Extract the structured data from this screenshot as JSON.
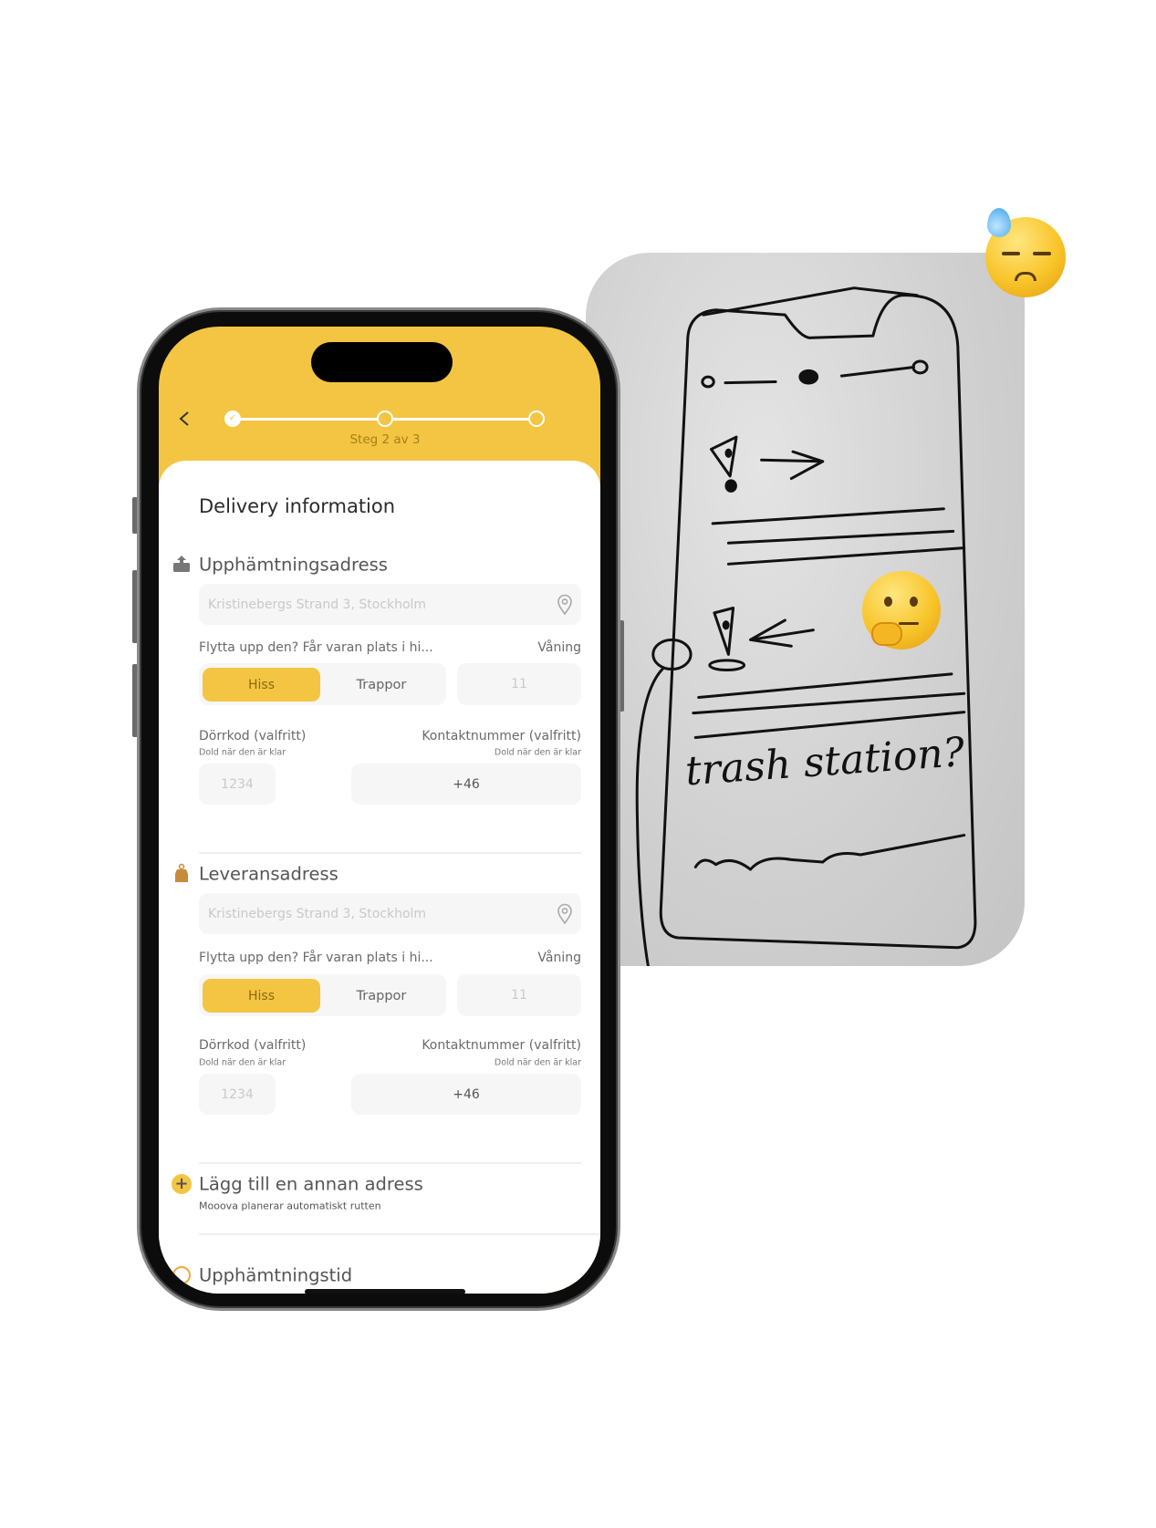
{
  "app": {
    "progress": {
      "step_label": "Steg 2 av 3",
      "current_step": 2,
      "total_steps": 3
    },
    "title": "Delivery information",
    "sections": [
      {
        "heading": "Upphämtningsadress",
        "icon": "upload-box-icon",
        "address_placeholder": "Kristinebergs Strand 3, Stockholm",
        "carry_question": "Flytta upp den? Får varan plats i hi...",
        "floor_label": "Våning",
        "options": [
          "Hiss",
          "Trappor"
        ],
        "selected_option": "Hiss",
        "floor_placeholder": "11",
        "door_code_label": "Dörrkod (valfritt)",
        "door_code_hint": "Dold när den är klar",
        "door_code_placeholder": "1234",
        "phone_label": "Kontaktnummer (valfritt)",
        "phone_hint": "Dold när den är klar",
        "phone_value": "+46"
      },
      {
        "heading": "Leveransadress",
        "icon": "shopping-bag-icon",
        "address_placeholder": "Kristinebergs Strand 3, Stockholm",
        "carry_question": "Flytta upp den? Får varan plats i hi...",
        "floor_label": "Våning",
        "options": [
          "Hiss",
          "Trappor"
        ],
        "selected_option": "Hiss",
        "floor_placeholder": "11",
        "door_code_label": "Dörrkod (valfritt)",
        "door_code_hint": "Dold när den är klar",
        "door_code_placeholder": "1234",
        "phone_label": "Kontaktnummer (valfritt)",
        "phone_hint": "Dold när den är klar",
        "phone_value": "+46"
      }
    ],
    "add_address": {
      "label": "Lägg till en annan adress",
      "subtitle": "Mooova planerar automatiskt rutten"
    },
    "pickup_time": {
      "heading": "Upphämtningstid"
    }
  },
  "sketch": {
    "handwriting": "trash station?"
  },
  "colors": {
    "accent": "#f4c542",
    "input_bg": "#f6f6f6",
    "sketch_bg": "#d2d2d2"
  }
}
